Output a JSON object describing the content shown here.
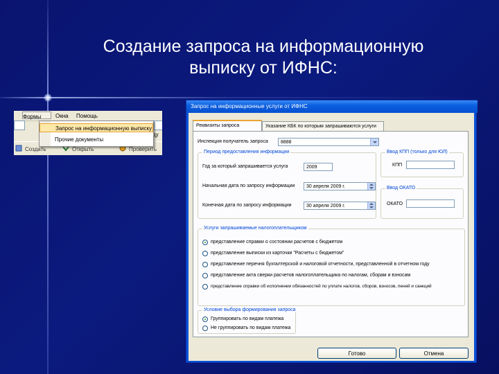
{
  "slide": {
    "title_line1": "Создание запроса на информационную",
    "title_line2": "выписку от ИФНС:"
  },
  "menu_snippet": {
    "menubar": [
      "Формы",
      "Окна",
      "Помощь"
    ],
    "dropdown_items": [
      "Запрос на информационную выписку",
      "Прочие документы"
    ],
    "toolbar_items": [
      "Создать",
      "Открыть",
      "Проверить"
    ],
    "right_fragment": "ду"
  },
  "dialog": {
    "title": "Запрос на информационные услуги от ИФНС",
    "tabs": [
      "Реквизиты запроса",
      "Указание КБК по которым запрашиваются услуги"
    ],
    "inspection_label": "Инспекция получатель запроса",
    "inspection_value": "8888",
    "period_group": {
      "title": "Период предоставления информации",
      "year_label": "Год за который запрашивается услуга",
      "year_value": "2009",
      "start_label": "Начальная дата по запросу информации",
      "start_value": "30 апреля 2009 г.",
      "end_label": "Конечная дата по запросу информации",
      "end_value": "30 апреля 2009 г."
    },
    "kpp_group": {
      "title": "Ввод КПП (только для ЮЛ)",
      "label": "КПП"
    },
    "okato_group": {
      "title": "Ввод ОКАТО",
      "label": "ОКАТО"
    },
    "services_group": {
      "title": "Услуги запрашиваемые налогоплательщиком",
      "options": [
        "представление справки о состоянии расчетов с бюджетом",
        "представление выписки из карточки \"Расчеты с бюджетом\"",
        "представление перечня бухгалтерской и налоговой отчетности, представленной в отчетном году",
        "представление акта сверки расчетов налогоплательщика по налогам, сборам и взносам",
        "представление справки об исполнении обязанностей по уплате налогов, сборов, взносов, пеней и санкций"
      ],
      "selected_index": 0
    },
    "format_group": {
      "title": "Условие выбора формирования запроса",
      "options": [
        "Группировать по видам платежа",
        "Не группировать по видам платежа"
      ],
      "selected_index": 0
    },
    "buttons": {
      "ok": "Готово",
      "cancel": "Отмена"
    }
  }
}
